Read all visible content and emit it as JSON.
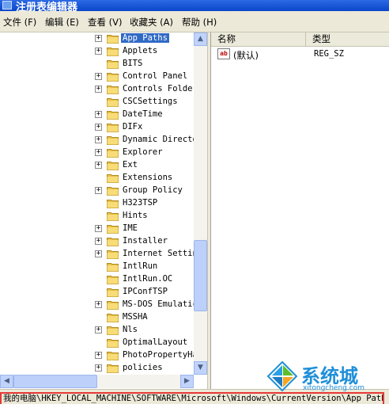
{
  "window": {
    "title": "注册表编辑器"
  },
  "menu": [
    {
      "label": "文件 (F)"
    },
    {
      "label": "编辑 (E)"
    },
    {
      "label": "查看 (V)"
    },
    {
      "label": "收藏夹 (A)"
    },
    {
      "label": "帮助 (H)"
    }
  ],
  "tree": {
    "items": [
      {
        "label": "App Paths",
        "expandable": true,
        "selected": true
      },
      {
        "label": "Applets",
        "expandable": true
      },
      {
        "label": "BITS",
        "expandable": false
      },
      {
        "label": "Control Panel",
        "expandable": true
      },
      {
        "label": "Controls Folder",
        "expandable": true
      },
      {
        "label": "CSCSettings",
        "expandable": false
      },
      {
        "label": "DateTime",
        "expandable": true
      },
      {
        "label": "DIFx",
        "expandable": true
      },
      {
        "label": "Dynamic Directo",
        "expandable": true
      },
      {
        "label": "Explorer",
        "expandable": true
      },
      {
        "label": "Ext",
        "expandable": true
      },
      {
        "label": "Extensions",
        "expandable": false
      },
      {
        "label": "Group Policy",
        "expandable": true
      },
      {
        "label": "H323TSP",
        "expandable": false
      },
      {
        "label": "Hints",
        "expandable": false
      },
      {
        "label": "IME",
        "expandable": true
      },
      {
        "label": "Installer",
        "expandable": true
      },
      {
        "label": "Internet Settin",
        "expandable": true
      },
      {
        "label": "IntlRun",
        "expandable": false
      },
      {
        "label": "IntlRun.OC",
        "expandable": false
      },
      {
        "label": "IPConfTSP",
        "expandable": false
      },
      {
        "label": "MS-DOS Emulatic",
        "expandable": true
      },
      {
        "label": "MSSHA",
        "expandable": false
      },
      {
        "label": "Nls",
        "expandable": true
      },
      {
        "label": "OptimalLayout",
        "expandable": false
      },
      {
        "label": "PhotoPropertyHa",
        "expandable": true
      },
      {
        "label": "policies",
        "expandable": true
      }
    ]
  },
  "values_pane": {
    "col_name": "名称",
    "col_type": "类型",
    "rows": [
      {
        "icon": "ab",
        "name": "(默认)",
        "type": "REG_SZ"
      }
    ]
  },
  "status": {
    "path": "我的电脑\\HKEY_LOCAL_MACHINE\\SOFTWARE\\Microsoft\\Windows\\CurrentVersion\\App Paths"
  },
  "watermark": {
    "text": "系统城",
    "sub": "xitongcheng.com"
  }
}
